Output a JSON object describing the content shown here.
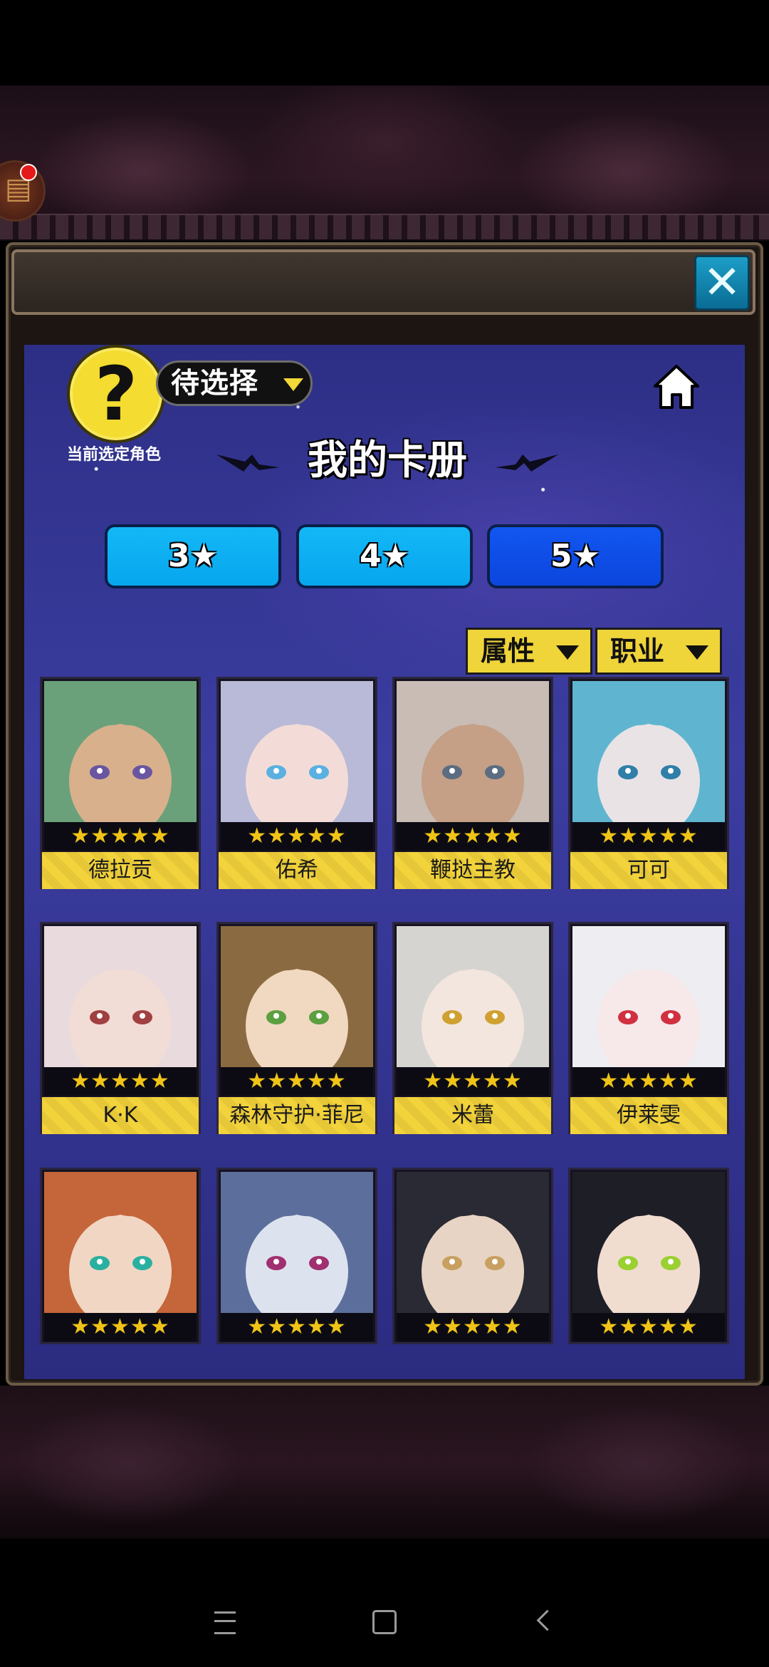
{
  "header": {
    "close_icon": "close-x-icon"
  },
  "selector": {
    "help_glyph": "?",
    "selected_label": "待选择",
    "current_role_label": "当前选定角色"
  },
  "album": {
    "title": "我的卡册"
  },
  "star_tabs": [
    {
      "label": "3★",
      "active": false
    },
    {
      "label": "4★",
      "active": false
    },
    {
      "label": "5★",
      "active": true
    }
  ],
  "filters": {
    "attribute": "属性",
    "job": "职业"
  },
  "cards": [
    {
      "name": "德拉贡",
      "stars": "★★★★★",
      "palette": [
        "#6aa17a",
        "#d8b08c",
        "#6a55a0"
      ]
    },
    {
      "name": "佑希",
      "stars": "★★★★★",
      "palette": [
        "#b9bad8",
        "#f3dcd8",
        "#5ab0e0"
      ]
    },
    {
      "name": "鞭挞主教",
      "stars": "★★★★★",
      "palette": [
        "#c8bcb4",
        "#c59f86",
        "#5c6d82"
      ]
    },
    {
      "name": "可可",
      "stars": "★★★★★",
      "palette": [
        "#5fb5cf",
        "#e9e3e6",
        "#2f7fa8"
      ]
    },
    {
      "name": "K·K",
      "stars": "★★★★★",
      "palette": [
        "#e8dadd",
        "#f2dcd6",
        "#a04040"
      ]
    },
    {
      "name": "森林守护·菲尼",
      "stars": "★★★★★",
      "palette": [
        "#8a6a40",
        "#f1d8c0",
        "#5aa040"
      ]
    },
    {
      "name": "米蕾",
      "stars": "★★★★★",
      "palette": [
        "#d6d4d0",
        "#f3e6de",
        "#d0a030"
      ]
    },
    {
      "name": "伊莱雯",
      "stars": "★★★★★",
      "palette": [
        "#eeeef2",
        "#f7e8ea",
        "#d03040"
      ]
    },
    {
      "name": "",
      "stars": "★★★★★",
      "palette": [
        "#c4663a",
        "#f2d6c4",
        "#2ab0a0"
      ]
    },
    {
      "name": "",
      "stars": "★★★★★",
      "palette": [
        "#5c6f9c",
        "#dde3ee",
        "#a03070"
      ]
    },
    {
      "name": "",
      "stars": "★★★★★",
      "palette": [
        "#2a2a34",
        "#e8d4c4",
        "#c8a060"
      ]
    },
    {
      "name": "",
      "stars": "★★★★★",
      "palette": [
        "#1e1e26",
        "#f1dcd0",
        "#9ad030"
      ]
    }
  ],
  "colors": {
    "panel_blue": "#34369a",
    "tab_cyan": "#10b0f2",
    "tab_blue_active": "#0d4fe6",
    "accent_yellow": "#f3d33b",
    "star_gold": "#f0c417"
  }
}
